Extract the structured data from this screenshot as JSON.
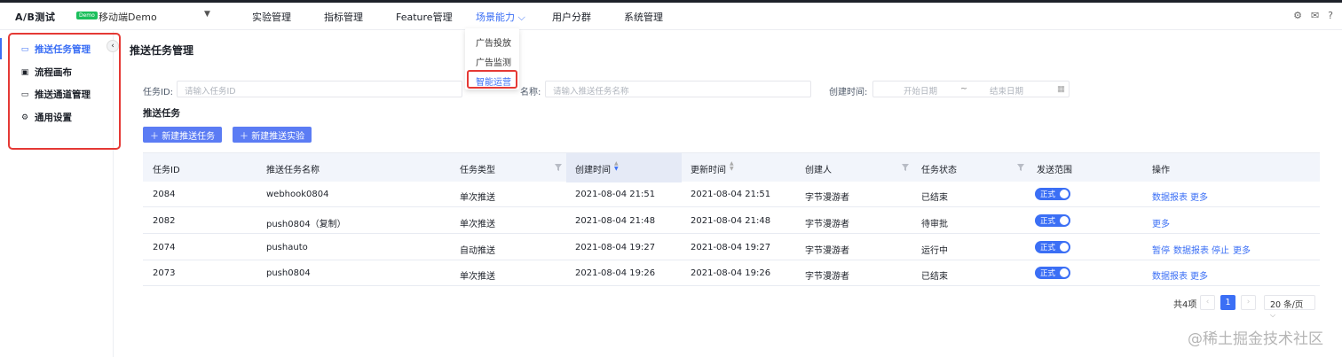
{
  "header": {
    "logo": "A/B测试",
    "demo_badge": "Demo",
    "project": "移动端Demo",
    "nav": [
      "实验管理",
      "指标管理",
      "Feature管理",
      "场景能力",
      "用户分群",
      "系统管理"
    ],
    "active_nav_index": 3
  },
  "dropdown": {
    "items": [
      "广告投放",
      "广告监测",
      "智能运营"
    ],
    "highlighted_index": 2
  },
  "sidebar": {
    "items": [
      {
        "label": "推送任务管理",
        "icon": "briefcase-icon",
        "active": true
      },
      {
        "label": "流程画布",
        "icon": "canvas-icon",
        "active": false
      },
      {
        "label": "推送通道管理",
        "icon": "briefcase-icon",
        "active": false
      },
      {
        "label": "通用设置",
        "icon": "gear-icon",
        "active": false
      }
    ]
  },
  "main": {
    "title": "推送任务管理",
    "filters": {
      "task_id_label": "任务ID:",
      "task_id_placeholder": "请输入任务ID",
      "task_name_label": "名称:",
      "task_name_placeholder": "请输入推送任务名称",
      "created_label": "创建时间:",
      "start_placeholder": "开始日期",
      "range_sep": "~",
      "end_placeholder": "结束日期"
    },
    "section_title": "推送任务",
    "buttons": {
      "new_task": "新建推送任务",
      "new_experiment": "新建推送实验"
    }
  },
  "table": {
    "headers": [
      "任务ID",
      "推送任务名称",
      "任务类型",
      "创建时间",
      "更新时间",
      "创建人",
      "任务状态",
      "发送范围",
      "操作"
    ],
    "rows": [
      {
        "id": "2084",
        "name": "webhook0804",
        "type": "单次推送",
        "created": "2021-08-04 21:51",
        "updated": "2021-08-04 21:51",
        "creator": "字节漫游者",
        "status": "已结束",
        "scope": "正式",
        "actions": [
          "数据报表",
          "更多"
        ]
      },
      {
        "id": "2082",
        "name": "push0804（复制）",
        "type": "单次推送",
        "created": "2021-08-04 21:48",
        "updated": "2021-08-04 21:48",
        "creator": "字节漫游者",
        "status": "待审批",
        "scope": "正式",
        "actions": [
          "更多"
        ]
      },
      {
        "id": "2074",
        "name": "pushauto",
        "type": "自动推送",
        "created": "2021-08-04 19:27",
        "updated": "2021-08-04 19:27",
        "creator": "字节漫游者",
        "status": "运行中",
        "scope": "正式",
        "actions": [
          "暂停",
          "数据报表",
          "停止",
          "更多"
        ]
      },
      {
        "id": "2073",
        "name": "push0804",
        "type": "单次推送",
        "created": "2021-08-04 19:26",
        "updated": "2021-08-04 19:26",
        "creator": "字节漫游者",
        "status": "已结束",
        "scope": "正式",
        "actions": [
          "数据报表",
          "更多"
        ]
      }
    ]
  },
  "pagination": {
    "total": "共4项",
    "current": "1",
    "page_size": "20 条/页"
  },
  "watermark": "@稀土掘金技术社区",
  "colors": {
    "accent": "#3b6ff5",
    "highlight_box": "#e53935",
    "demo_badge": "#1bbf5c"
  }
}
